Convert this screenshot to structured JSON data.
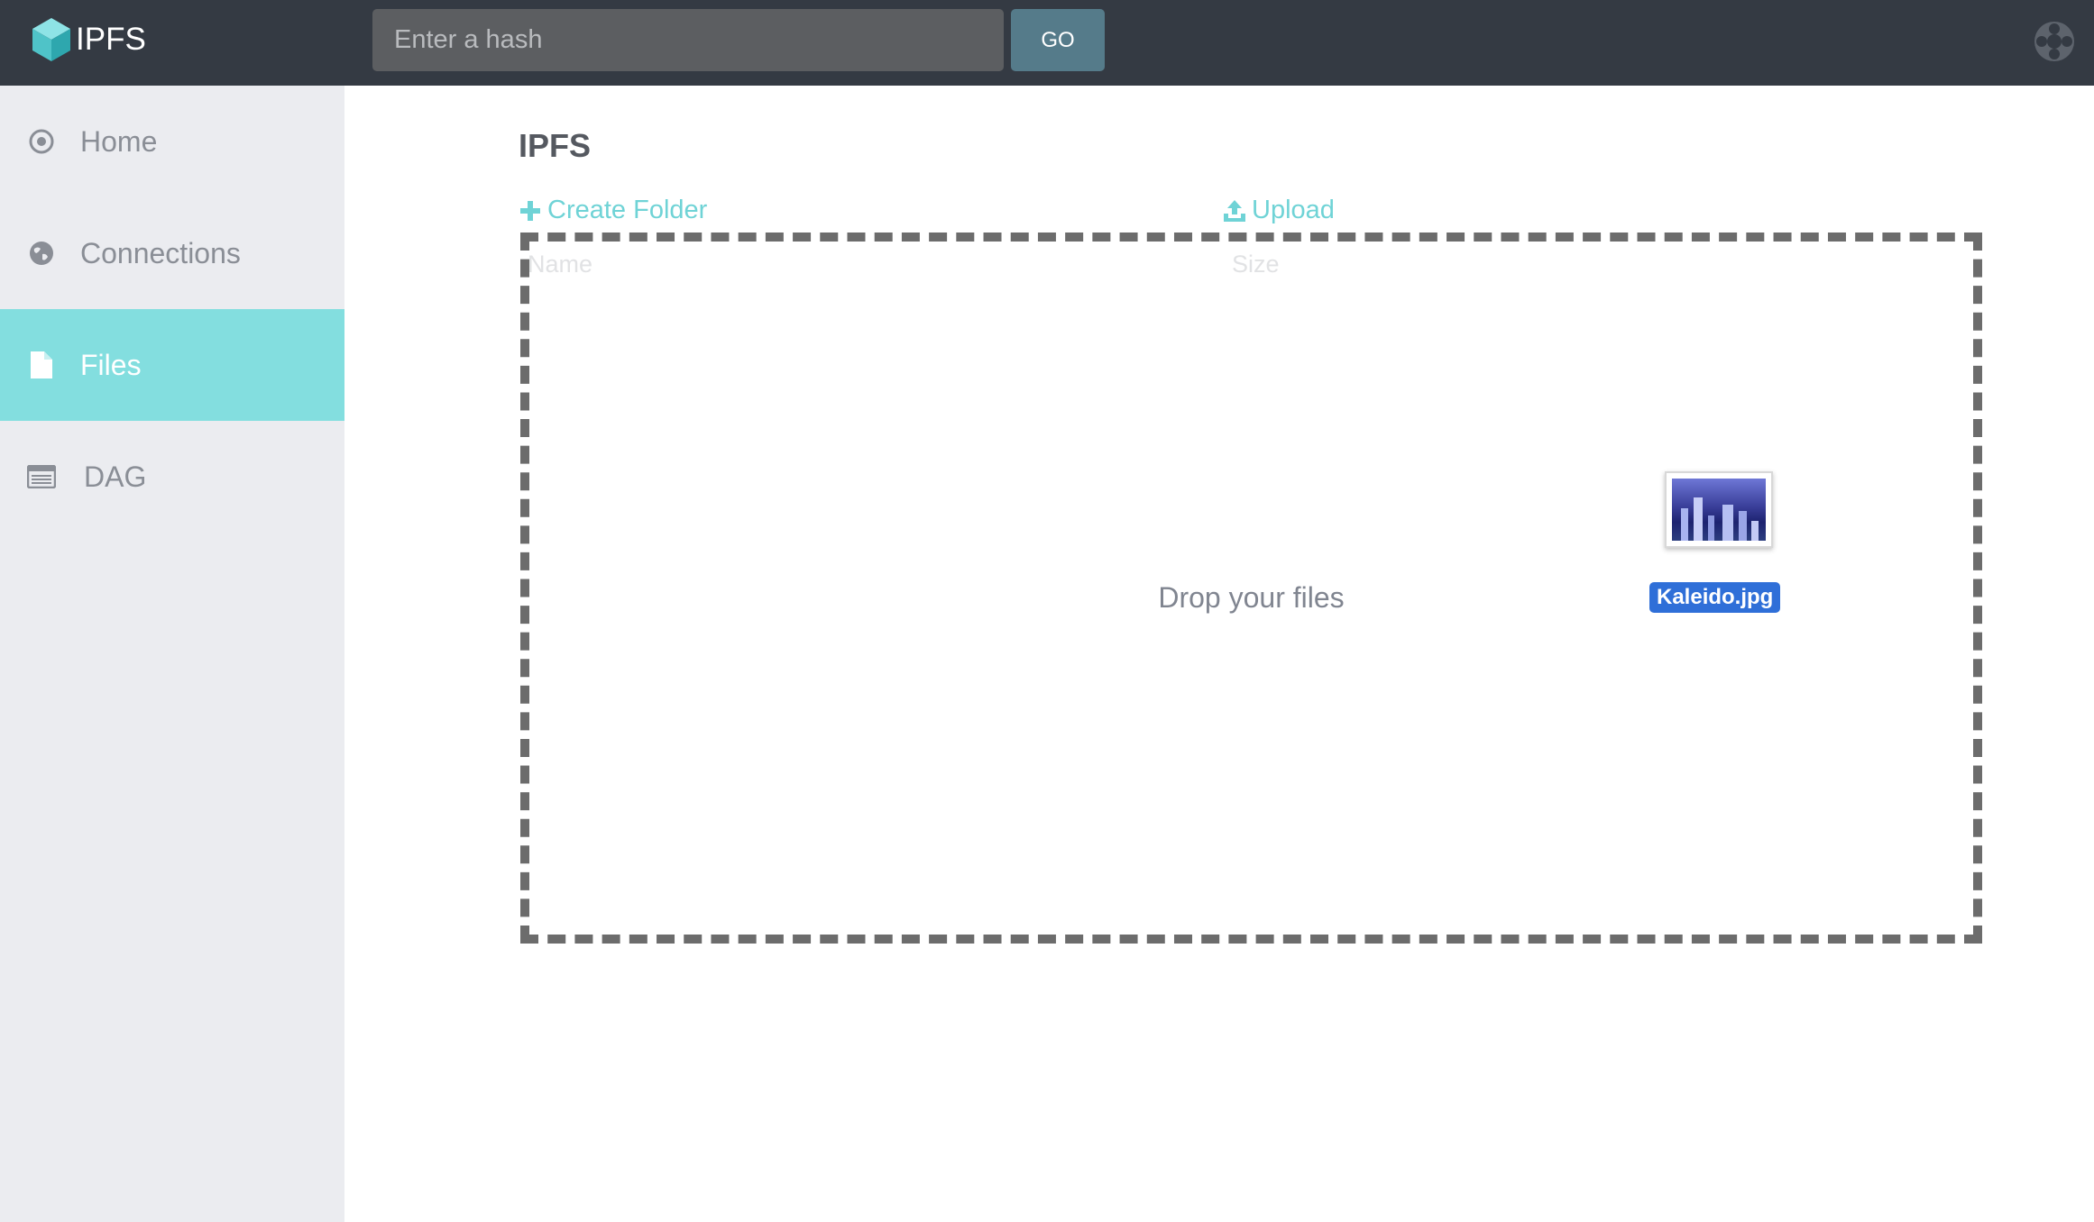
{
  "header": {
    "app_name": "IPFS",
    "hash_input": {
      "placeholder": "Enter a hash",
      "value": ""
    },
    "go_label": "GO",
    "icons": {
      "logo": "ipfs-cube-icon",
      "settings": "settings-icon"
    }
  },
  "sidebar": {
    "items": [
      {
        "label": "Home",
        "icon": "home-icon",
        "active": false
      },
      {
        "label": "Connections",
        "icon": "globe-icon",
        "active": false
      },
      {
        "label": "Files",
        "icon": "file-icon",
        "active": true
      },
      {
        "label": "DAG",
        "icon": "dag-icon",
        "active": false
      }
    ]
  },
  "main": {
    "title": "IPFS",
    "actions": {
      "create_folder": "Create Folder",
      "upload": "Upload"
    },
    "table": {
      "columns": [
        "Name",
        "Size"
      ]
    },
    "dropzone_text": "Drop your files"
  },
  "drag": {
    "file_name": "Kaleido.jpg"
  },
  "colors": {
    "topbar": "#343a43",
    "sidebar": "#ebecf0",
    "active": "#83dedf",
    "accent": "#6fd3d6",
    "go_button": "#557b8a",
    "selection": "#2f6fd8"
  }
}
